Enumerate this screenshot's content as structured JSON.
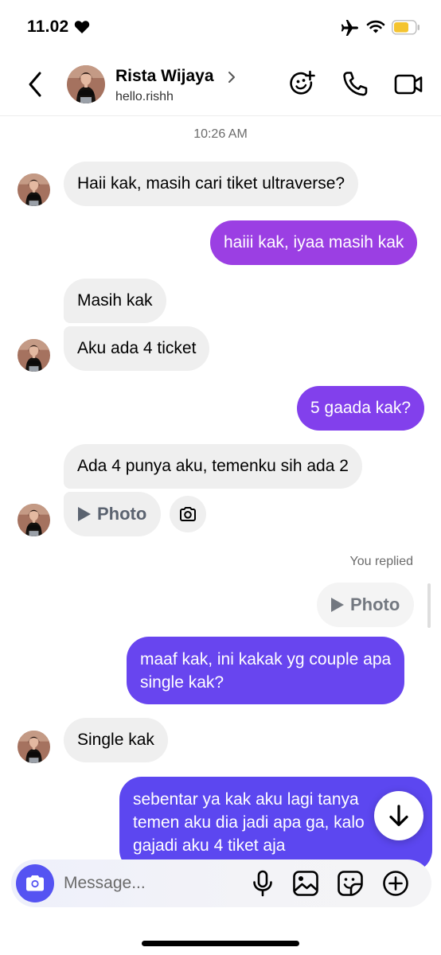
{
  "status_bar": {
    "time": "11.02"
  },
  "header": {
    "contact_name": "Rista Wijaya",
    "username": "hello.rishh"
  },
  "conversation": {
    "timestamp": "10:26 AM",
    "msg1": "Haii kak, masih cari tiket ultraverse?",
    "msg2": "haiii kak, iyaa masih kak",
    "msg3": "Masih kak",
    "msg4": "Aku ada 4 ticket",
    "msg5": "5 gaada kak?",
    "msg6": "Ada 4 punya aku, temenku sih ada 2",
    "photo_label": "Photo",
    "replied_label": "You replied",
    "reply_photo_label": "Photo",
    "msg7_line1": "maaf kak, ini kakak yg couple apa",
    "msg7_line2": "single kak?",
    "msg8": "Single kak",
    "msg9_line1": "sebentar ya kak aku lagi tanya",
    "msg9_line2": "temen aku dia jadi apa ga, kalo",
    "msg9_line3": "gajadi aku 4 tiket aja"
  },
  "composer": {
    "placeholder": "Message..."
  },
  "colors": {
    "outgoing_top": "#9b3fe3",
    "outgoing_mid": "#7f3ff0",
    "outgoing_bottom": "#5c47f0",
    "incoming": "#efefef",
    "camera_button": "#5553f2"
  },
  "icons": {
    "back": "chevron-left-icon",
    "effects": "sticker-face-plus-icon",
    "voice_call": "phone-icon",
    "video_call": "video-camera-icon",
    "mic": "microphone-icon",
    "gallery": "image-icon",
    "sticker": "sticker-icon",
    "more": "plus-circle-icon",
    "scroll": "arrow-down-icon"
  }
}
